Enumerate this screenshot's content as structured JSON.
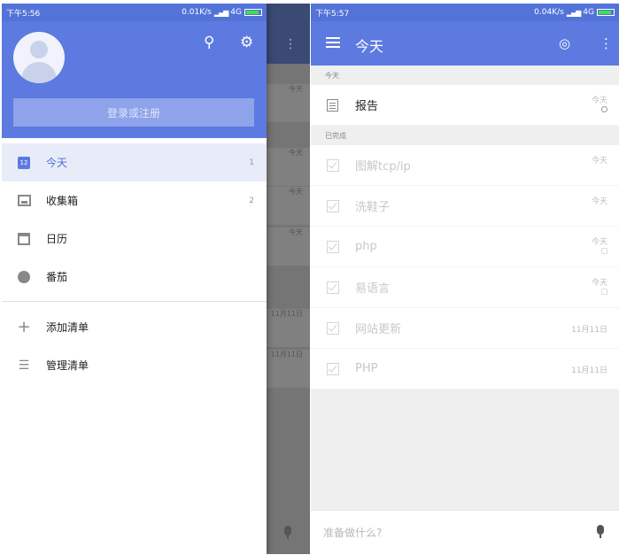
{
  "left": {
    "status": {
      "time": "下午5:56",
      "speed": "0.01K/s",
      "network": "4G"
    },
    "underlying_dates": [
      "今天",
      "今天",
      "今天",
      "今天",
      "11月11日",
      "11月11日"
    ],
    "drawer": {
      "login_label": "登录或注册",
      "menu": [
        {
          "label": "今天",
          "count": "1",
          "icon": "calendar-today-icon",
          "cal_day": "12"
        },
        {
          "label": "收集箱",
          "count": "2",
          "icon": "inbox-icon"
        },
        {
          "label": "日历",
          "count": "",
          "icon": "calendar-grid-icon"
        },
        {
          "label": "番茄",
          "count": "",
          "icon": "tomato-timer-icon"
        }
      ],
      "actions": [
        {
          "label": "添加清单",
          "icon": "plus-icon"
        },
        {
          "label": "管理清单",
          "icon": "list-settings-icon"
        }
      ]
    }
  },
  "right": {
    "status": {
      "time": "下午5:57",
      "speed": "0.04K/s",
      "network": "4G"
    },
    "title": "今天",
    "sections": [
      {
        "label": "今天",
        "tasks": [
          {
            "title": "报告",
            "date": "今天",
            "done": false
          }
        ]
      },
      {
        "label": "已完成",
        "tasks": [
          {
            "title": "图解tcp/ip",
            "date": "今天",
            "done": true
          },
          {
            "title": "洗鞋子",
            "date": "今天",
            "done": true
          },
          {
            "title": "php",
            "date": "今天",
            "done": true
          },
          {
            "title": "易语言",
            "date": "今天",
            "done": true
          },
          {
            "title": "网站更新",
            "date": "11月11日",
            "done": true
          },
          {
            "title": "PHP",
            "date": "11月11日",
            "done": true
          }
        ]
      }
    ],
    "add_placeholder": "准备做什么?"
  },
  "colors": {
    "accent": "#5c7ae0",
    "active_bg": "#e8ecf9"
  }
}
